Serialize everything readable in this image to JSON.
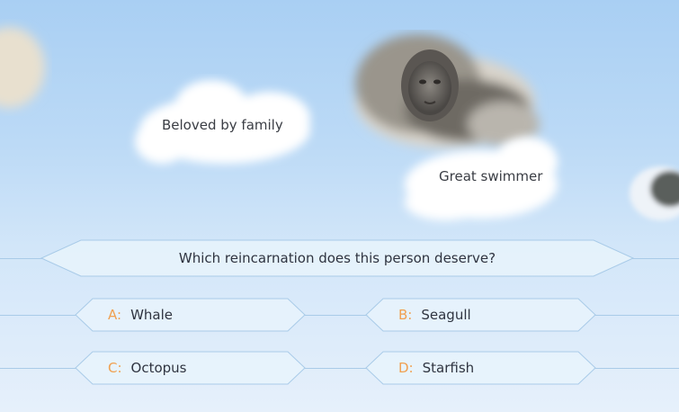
{
  "clues": [
    {
      "text": "Beloved by family"
    },
    {
      "text": "Great swimmer"
    }
  ],
  "question": "Which reincarnation does this person deserve?",
  "answers": [
    {
      "letter": "A:",
      "text": "Whale"
    },
    {
      "letter": "B:",
      "text": "Seagull"
    },
    {
      "letter": "C:",
      "text": "Octopus"
    },
    {
      "letter": "D:",
      "text": "Starfish"
    }
  ],
  "colors": {
    "sky_top": "#a9cff3",
    "letter": "#f0a050",
    "outline": "#a9cbe8"
  }
}
